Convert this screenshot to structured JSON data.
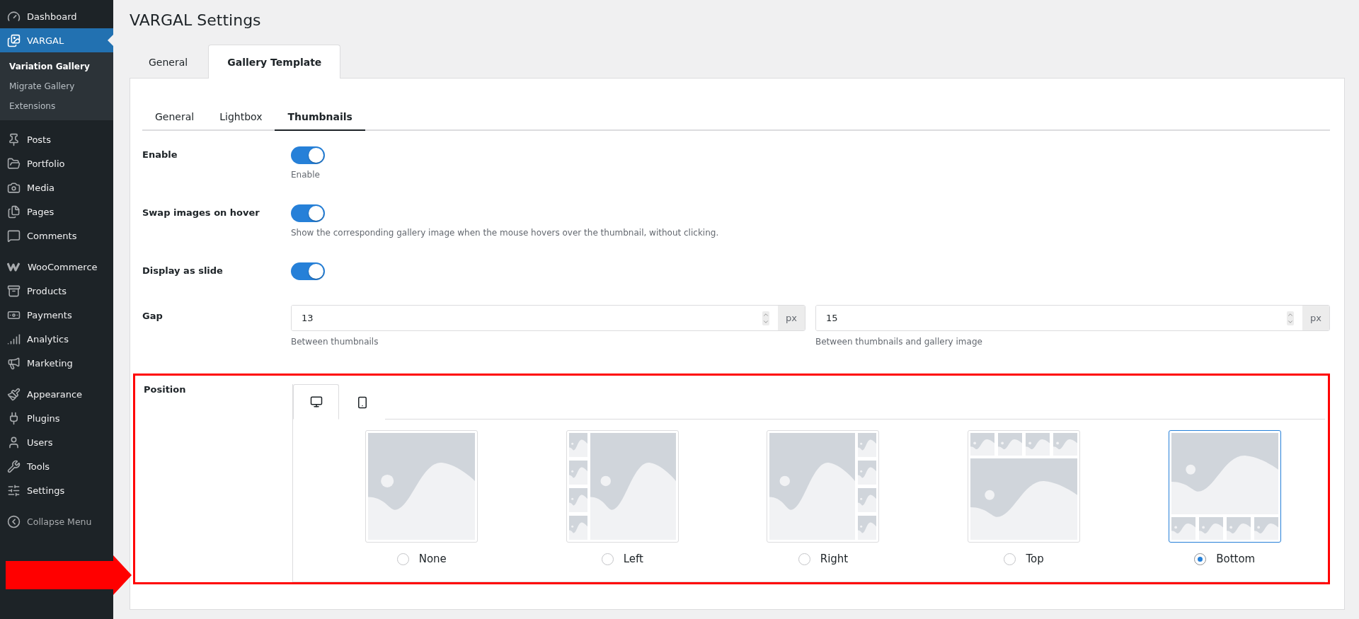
{
  "sidebar": {
    "sections": [
      {
        "items": [
          {
            "label": "Dashboard",
            "selected": false
          },
          {
            "label": "VARGAL",
            "selected": true,
            "children": [
              {
                "label": "Variation Gallery",
                "selected": true
              },
              {
                "label": "Migrate Gallery",
                "selected": false
              },
              {
                "label": "Extensions",
                "selected": false
              }
            ]
          }
        ]
      },
      {
        "items": [
          {
            "label": "Posts",
            "selected": false
          },
          {
            "label": "Portfolio",
            "selected": false
          },
          {
            "label": "Media",
            "selected": false
          },
          {
            "label": "Pages",
            "selected": false
          },
          {
            "label": "Comments",
            "selected": false
          }
        ]
      },
      {
        "items": [
          {
            "label": "WooCommerce",
            "selected": false
          },
          {
            "label": "Products",
            "selected": false
          },
          {
            "label": "Payments",
            "selected": false
          },
          {
            "label": "Analytics",
            "selected": false
          },
          {
            "label": "Marketing",
            "selected": false
          }
        ]
      },
      {
        "items": [
          {
            "label": "Appearance",
            "selected": false
          },
          {
            "label": "Plugins",
            "selected": false
          },
          {
            "label": "Users",
            "selected": false
          },
          {
            "label": "Tools",
            "selected": false
          },
          {
            "label": "Settings",
            "selected": false
          }
        ]
      }
    ],
    "collapse": "Collapse Menu"
  },
  "page_title": "VARGAL Settings",
  "tabs": [
    {
      "label": "General",
      "selected": false
    },
    {
      "label": "Gallery Template",
      "selected": true
    }
  ],
  "subtabs": [
    {
      "label": "General",
      "selected": false
    },
    {
      "label": "Lightbox",
      "selected": false
    },
    {
      "label": "Thumbnails",
      "selected": true
    }
  ],
  "settings": [
    {
      "kind": "toggle",
      "label": "Enable",
      "on": true,
      "description": "Enable"
    },
    {
      "kind": "toggle",
      "label": "Swap images on hover",
      "on": true,
      "description": "Show the corresponding gallery image when the mouse hovers over the thumbnail, without clicking."
    },
    {
      "kind": "toggle",
      "label": "Display as slide",
      "on": true
    },
    {
      "kind": "number",
      "label": "Gap",
      "fields": [
        {
          "value": "13",
          "unit": "px",
          "description": "Between thumbnails"
        },
        {
          "value": "15",
          "unit": "px",
          "description": "Between thumbnails and gallery image"
        }
      ]
    },
    {
      "kind": "position",
      "label": "Position",
      "highlighted": true,
      "devices": [
        {
          "selected": true
        },
        {
          "selected": false
        }
      ],
      "options": [
        {
          "label": "None",
          "kind": "none",
          "selected": false
        },
        {
          "label": "Left",
          "kind": "left",
          "selected": false
        },
        {
          "label": "Right",
          "kind": "right",
          "selected": false
        },
        {
          "label": "Top",
          "kind": "top",
          "selected": false
        },
        {
          "label": "Bottom",
          "kind": "bottom",
          "selected": true
        }
      ]
    }
  ],
  "annotation_arrow": true
}
